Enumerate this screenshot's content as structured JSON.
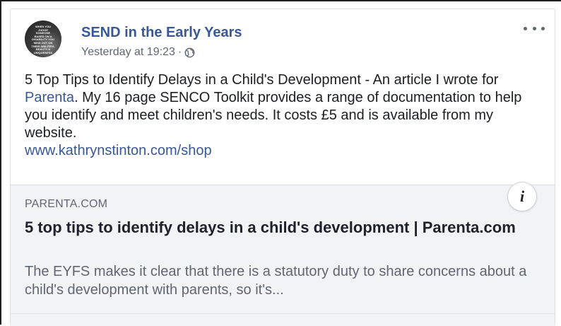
{
  "post": {
    "page_name": "SEND in the Early Years",
    "timestamp": "Yesterday at 19:23",
    "separator": "·",
    "privacy_icon": "globe-icon",
    "more_icon": "more-options-icon",
    "avatar_text": "WHEN YOU JUDGE SOMEONE BASED ON A DISABILITY YOU MISS OUT ON THEIR ABILITIES, BEAUTY & UNIQUENESS",
    "text_part1": "5 Top Tips to Identify Delays in a Child's Development - An article I wrote for ",
    "mention": "Parenta",
    "text_part2": ". My 16 page SENCO Toolkit provides a range of documentation to help you identify and meet children's needs. It costs £5 and is available from my website.",
    "url": "www.kathrynstinton.com/shop"
  },
  "link_preview": {
    "domain": "PARENTA.COM",
    "title": "5 top tips to identify delays in a child's development | Parenta.com",
    "description": "The EYFS makes it clear that there is a statutory duty to share concerns about a child's development with parents, so it's...",
    "info_label": "i"
  },
  "colors": {
    "link": "#385898",
    "text": "#1c1e21",
    "secondary": "#606770",
    "preview_bg": "#f2f3f5"
  }
}
